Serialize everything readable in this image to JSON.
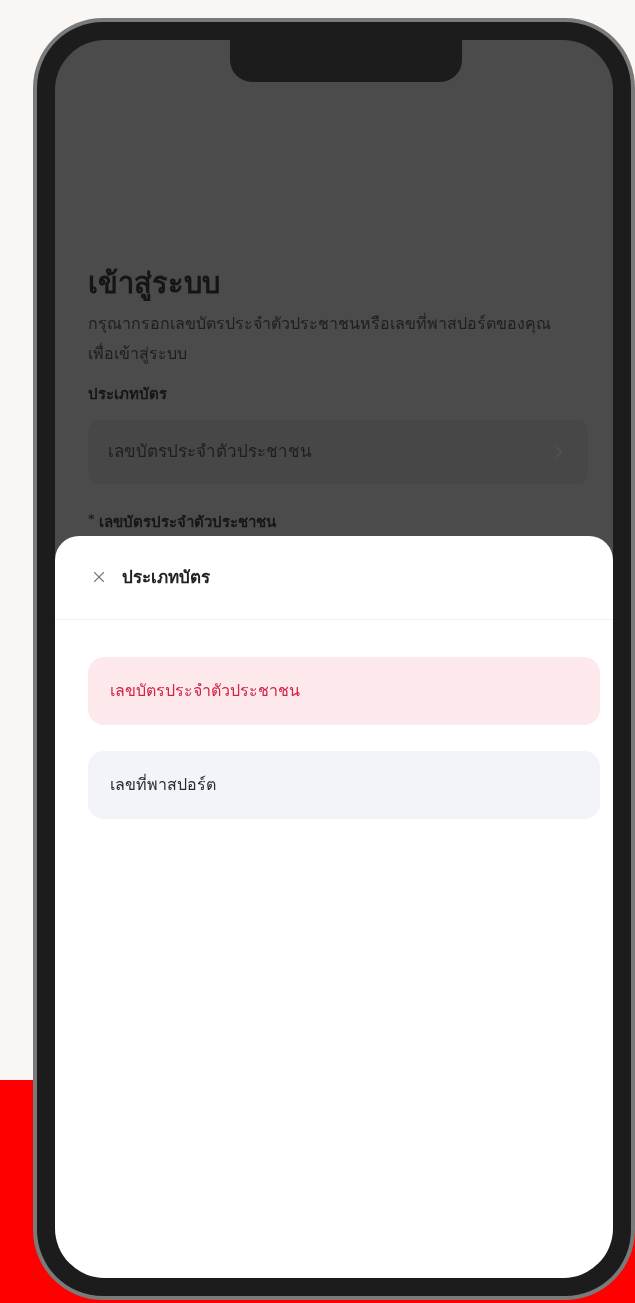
{
  "login": {
    "title": "เข้าสู่ระบบ",
    "description": "กรุณากรอกเลขบัตรประจำตัวประชาชนหรือเลขที่พาสปอร์ตของคุณ เพื่อเข้าสู่ระบบ",
    "card_type_label": "ประเภทบัตร",
    "card_type_value": "เลขบัตรประจำตัวประชาชน",
    "id_field": {
      "required_mark": "*",
      "label": "เลขบัตรประจำตัวประชาชน"
    }
  },
  "sheet": {
    "title": "ประเภทบัตร",
    "options": [
      {
        "label": "เลขบัตรประจำตัวประชาชน",
        "selected": true
      },
      {
        "label": "เลขที่พาสปอร์ต",
        "selected": false
      }
    ]
  }
}
